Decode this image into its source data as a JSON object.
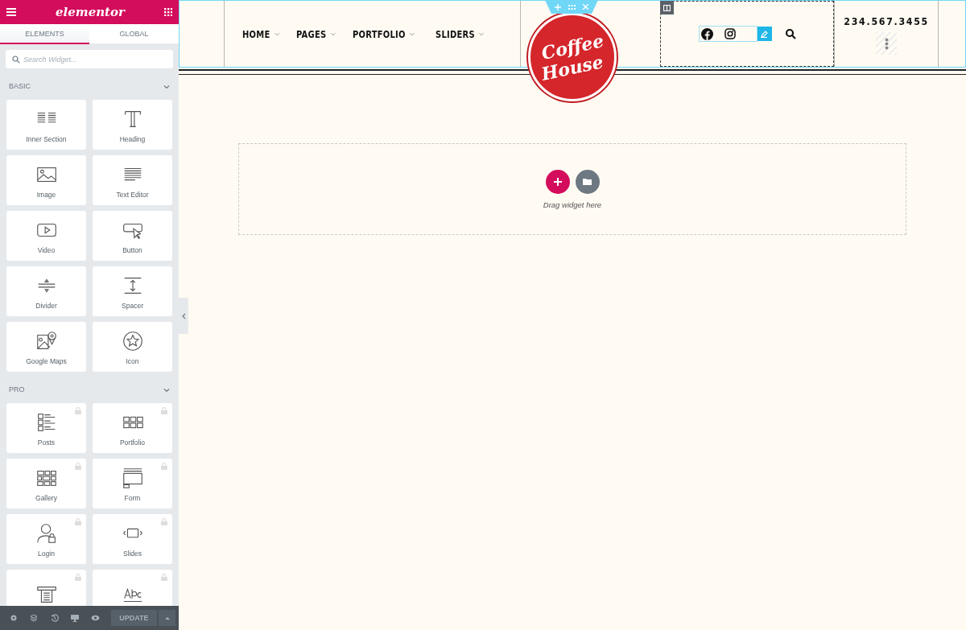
{
  "editor": {
    "logo": "elementor",
    "tabs": [
      {
        "label": "ELEMENTS",
        "selected": true
      },
      {
        "label": "GLOBAL",
        "selected": false
      }
    ],
    "search": {
      "placeholder": "Search Widget..."
    },
    "categories": [
      {
        "title": "BASIC",
        "expanded": true,
        "widgets": [
          {
            "label": "Inner Section",
            "locked": false
          },
          {
            "label": "Heading",
            "locked": false
          },
          {
            "label": "Image",
            "locked": false
          },
          {
            "label": "Text Editor",
            "locked": false
          },
          {
            "label": "Video",
            "locked": false
          },
          {
            "label": "Button",
            "locked": false
          },
          {
            "label": "Divider",
            "locked": false
          },
          {
            "label": "Spacer",
            "locked": false
          },
          {
            "label": "Google Maps",
            "locked": false
          },
          {
            "label": "Icon",
            "locked": false
          }
        ]
      },
      {
        "title": "PRO",
        "expanded": true,
        "widgets": [
          {
            "label": "Posts",
            "locked": true
          },
          {
            "label": "Portfolio",
            "locked": true
          },
          {
            "label": "Gallery",
            "locked": true
          },
          {
            "label": "Form",
            "locked": true
          },
          {
            "label": "Login",
            "locked": true
          },
          {
            "label": "Slides",
            "locked": true
          },
          {
            "locked": true
          },
          {
            "locked": true
          }
        ]
      }
    ],
    "footer": {
      "update_button": "UPDATE"
    }
  },
  "page": {
    "nav": [
      {
        "label": "HOME"
      },
      {
        "label": "PAGES"
      },
      {
        "label": "PORTFOLIO"
      },
      {
        "label": "SLIDERS"
      }
    ],
    "logo": {
      "line_1": "Coffee",
      "line_2": "House"
    },
    "phone": "234.567.3455",
    "drop_zone": {
      "hint": "Drag widget here"
    }
  }
}
